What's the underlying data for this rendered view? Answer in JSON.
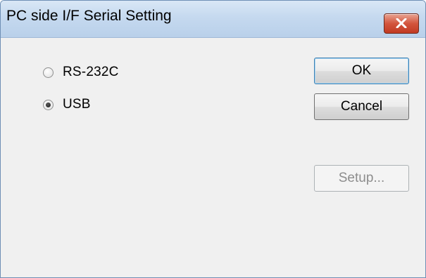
{
  "window": {
    "title": "PC side I/F Serial Setting",
    "close_icon": "close-icon"
  },
  "options": [
    {
      "label": "RS-232C",
      "selected": false
    },
    {
      "label": "USB",
      "selected": true
    }
  ],
  "buttons": {
    "ok": "OK",
    "cancel": "Cancel",
    "setup": "Setup...",
    "setup_enabled": false
  },
  "colors": {
    "close_button": "#c9452c",
    "title_bar": "#c5d9ef"
  }
}
